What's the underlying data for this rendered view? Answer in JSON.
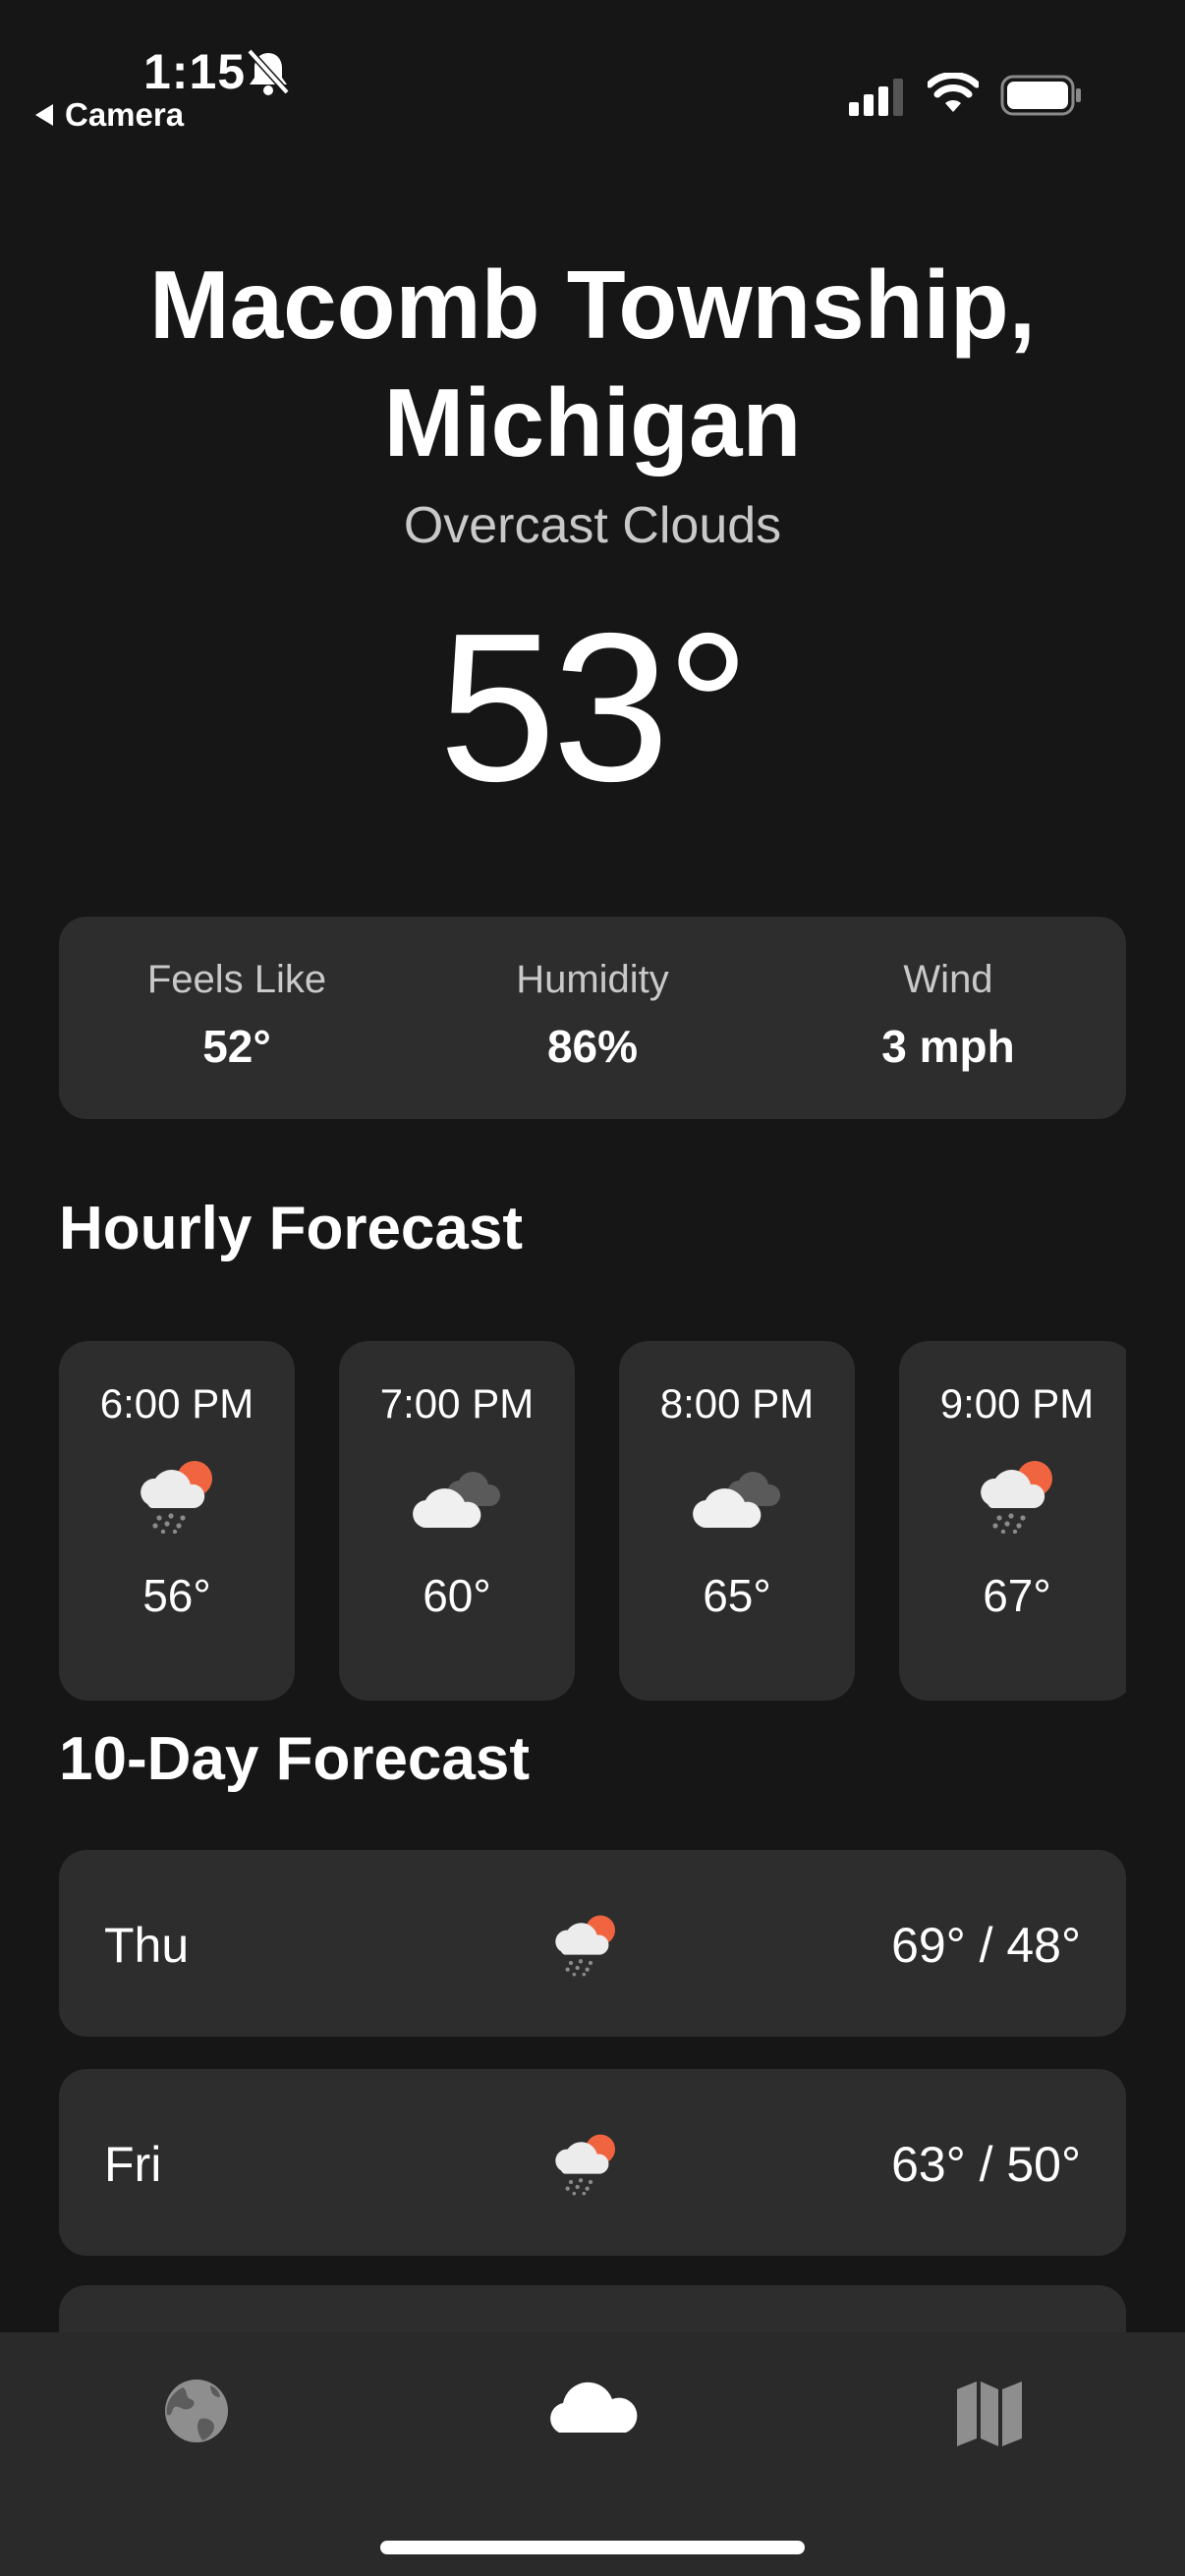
{
  "status_bar": {
    "time": "1:15",
    "back_label": "Camera"
  },
  "header": {
    "city_line1": "Macomb Township,",
    "city_line2": "Michigan",
    "condition": "Overcast Clouds",
    "temperature": "53°"
  },
  "stats": [
    {
      "label": "Feels Like",
      "value": "52°"
    },
    {
      "label": "Humidity",
      "value": "86%"
    },
    {
      "label": "Wind",
      "value": "3 mph"
    }
  ],
  "hourly": {
    "title": "Hourly Forecast",
    "items": [
      {
        "time": "6:00 PM",
        "icon": "sun-rain-cloud-icon",
        "temp": "56°"
      },
      {
        "time": "7:00 PM",
        "icon": "cloud-icon",
        "temp": "60°"
      },
      {
        "time": "8:00 PM",
        "icon": "cloud-icon",
        "temp": "65°"
      },
      {
        "time": "9:00 PM",
        "icon": "sun-rain-cloud-icon",
        "temp": "67°"
      }
    ]
  },
  "daily": {
    "title": "10-Day Forecast",
    "items": [
      {
        "day": "Thu",
        "icon": "sun-rain-cloud-icon",
        "range": "69° / 48°"
      },
      {
        "day": "Fri",
        "icon": "sun-rain-cloud-icon",
        "range": "63° / 50°"
      }
    ]
  },
  "tabs": [
    {
      "icon": "globe-icon",
      "selected": false
    },
    {
      "icon": "cloud-icon",
      "selected": true
    },
    {
      "icon": "map-icon",
      "selected": false
    }
  ],
  "colors": {
    "background": "#161616",
    "card": "#2d2d2d",
    "sun": "#f0653f",
    "tab_bar": "#2a2a2a"
  }
}
